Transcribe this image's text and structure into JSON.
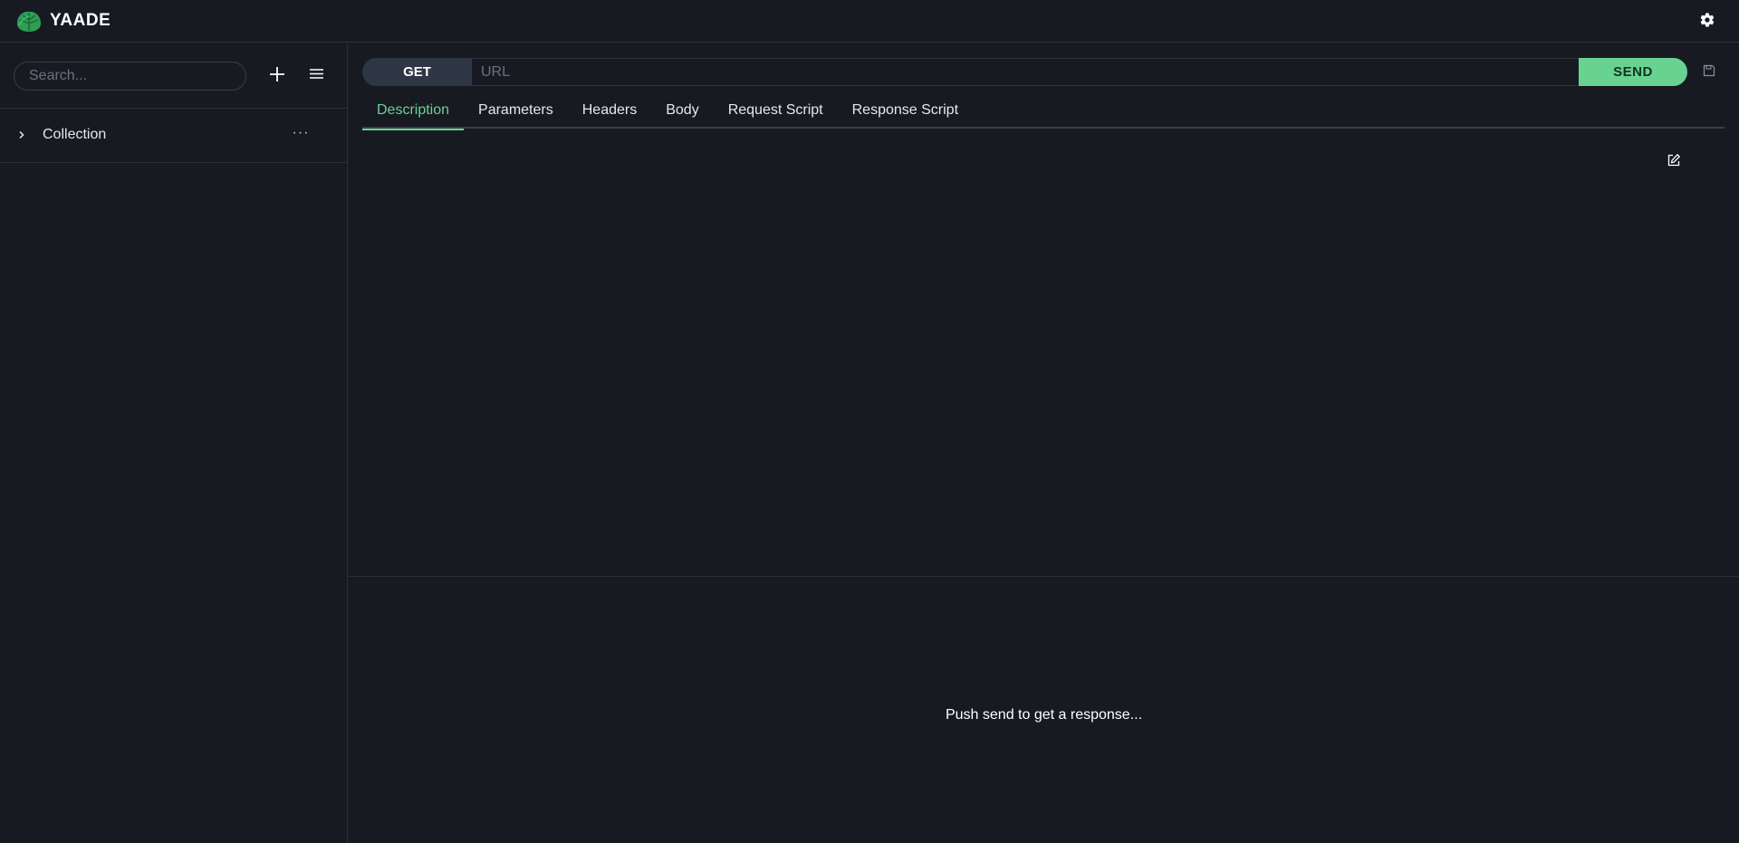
{
  "app": {
    "name": "YAADE",
    "accent_color": "#68d391",
    "background_color": "#181a22"
  },
  "header": {
    "logo_icon": "leaf-logo-icon",
    "settings_icon": "gear-icon"
  },
  "sidebar": {
    "search_placeholder": "Search...",
    "add_icon": "plus-icon",
    "menu_icon": "hamburger-menu-icon",
    "collections": [
      {
        "name": "Collection",
        "expanded": false,
        "more_label": "···"
      }
    ]
  },
  "request": {
    "method": "GET",
    "url_placeholder": "URL",
    "url_value": "",
    "send_label": "SEND",
    "save_icon": "floppy-disk-icon",
    "tabs": [
      {
        "label": "Description",
        "active": true
      },
      {
        "label": "Parameters",
        "active": false
      },
      {
        "label": "Headers",
        "active": false
      },
      {
        "label": "Body",
        "active": false
      },
      {
        "label": "Request Script",
        "active": false
      },
      {
        "label": "Response Script",
        "active": false
      }
    ],
    "edit_icon": "edit-icon"
  },
  "response": {
    "message": "Push send to get a response..."
  }
}
